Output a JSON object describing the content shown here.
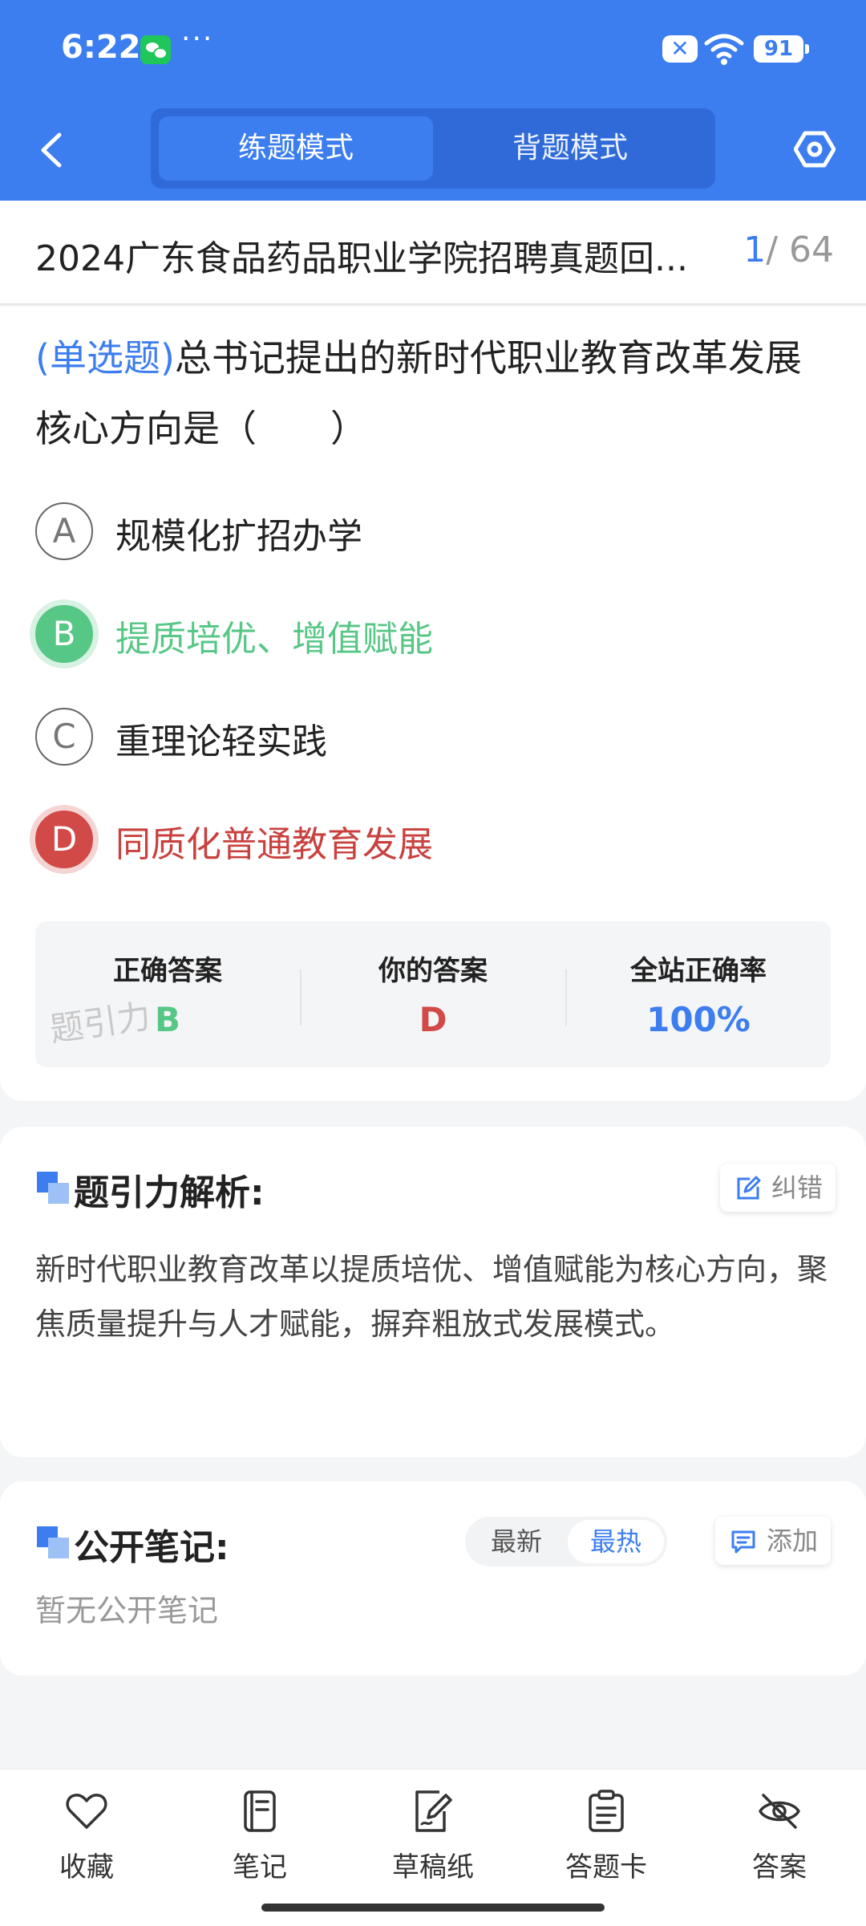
{
  "status_bar": {
    "time": "6:22",
    "dots": "···",
    "x_badge": "✕",
    "battery": "91"
  },
  "header": {
    "modes": [
      {
        "label": "练题模式",
        "active": true
      },
      {
        "label": "背题模式",
        "active": false
      }
    ],
    "icons": [
      "back-icon",
      "settings-icon"
    ]
  },
  "title_row": {
    "title": "2024广东食品药品职业学院招聘真题回...",
    "current": "1",
    "total": "/ 64"
  },
  "question": {
    "type": "(单选题)",
    "stem": "总书记提出的新时代职业教育改革发展核心方向是（　　）",
    "options": [
      {
        "key": "A",
        "text": "规模化扩招办学",
        "state": "normal"
      },
      {
        "key": "B",
        "text": "提质培优、增值赋能",
        "state": "correct"
      },
      {
        "key": "C",
        "text": "重理论轻实践",
        "state": "normal"
      },
      {
        "key": "D",
        "text": "同质化普通教育发展",
        "state": "wrong"
      }
    ]
  },
  "stats": {
    "correct_label": "正确答案",
    "correct_value": "B",
    "yours_label": "你的答案",
    "yours_value": "D",
    "rate_label": "全站正确率",
    "rate_value": "100%",
    "watermark": "题引力"
  },
  "analysis": {
    "title": "题引力解析:",
    "report_label": "纠错",
    "text": "新时代职业教育改革以提质培优、增值赋能为核心方向，聚焦质量提升与人才赋能，摒弃粗放式发展模式。"
  },
  "notes": {
    "title": "公开笔记:",
    "sort_latest": "最新",
    "sort_hot": "最热",
    "add_label": "添加",
    "empty": "暂无公开笔记"
  },
  "bottom_nav": [
    {
      "label": "收藏",
      "icon": "heart-icon"
    },
    {
      "label": "笔记",
      "icon": "notebook-icon"
    },
    {
      "label": "草稿纸",
      "icon": "draft-paper-icon"
    },
    {
      "label": "答题卡",
      "icon": "answer-sheet-icon"
    },
    {
      "label": "答案",
      "icon": "eye-off-icon"
    }
  ],
  "colors": {
    "primary": "#3c7df0",
    "correct": "#57c786",
    "wrong": "#d14a47"
  }
}
